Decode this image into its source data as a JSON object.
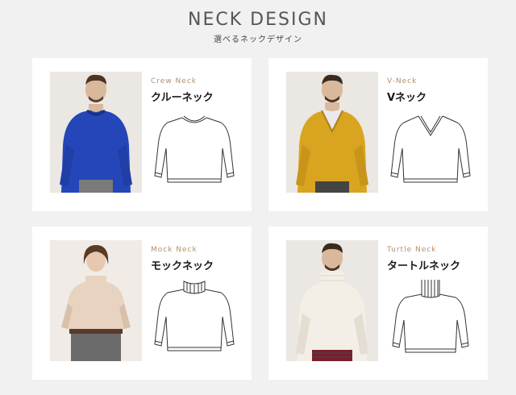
{
  "header": {
    "title": "NECK DESIGN",
    "subtitle": "選べるネックデザイン"
  },
  "cards": [
    {
      "name_en": "Crew Neck",
      "name_jp": "クルーネック",
      "sweater_color": "#2446b8",
      "photo_bg": "#ebe7e2"
    },
    {
      "name_en": "V-Neck",
      "name_jp": "Vネック",
      "sweater_color": "#d9a520",
      "photo_bg": "#ebe7e2"
    },
    {
      "name_en": "Mock Neck",
      "name_jp": "モックネック",
      "sweater_color": "#e8d3c0",
      "photo_bg": "#f0ebe6"
    },
    {
      "name_en": "Turtle Neck",
      "name_jp": "タートルネック",
      "sweater_color": "#f3efe6",
      "photo_bg": "#ebe7e2"
    }
  ],
  "colors": {
    "background": "#f1f1f1",
    "card": "#ffffff",
    "accent_label": "#b38f6a"
  }
}
